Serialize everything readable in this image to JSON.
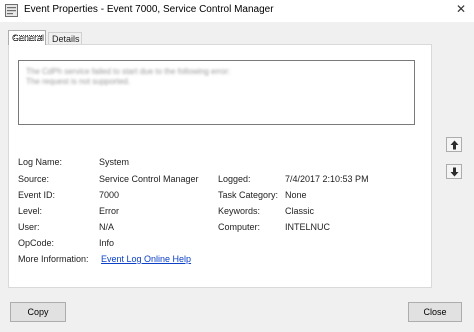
{
  "window": {
    "title": "Event Properties - Event 7000, Service Control Manager",
    "close_glyph": "✕"
  },
  "tabs": [
    {
      "label": "General",
      "selected": true
    },
    {
      "label": "Details",
      "selected": false
    }
  ],
  "description": {
    "lines": [
      "The CdPh service failed to start due to the following error:",
      "The request is not supported."
    ],
    "blurred": true
  },
  "fields": {
    "log_name": {
      "label_pre": "Log Name:",
      "value": "System"
    },
    "source": {
      "label_pre": "Source:",
      "value": "Service Control Manager"
    },
    "logged": {
      "label_pre": "Logged:",
      "value": "7/4/2017 2:10:53 PM"
    },
    "event_id": {
      "label_pre": "Event ID:",
      "value": "7000"
    },
    "task_category": {
      "label_pre": "Task Category:",
      "value": "None"
    },
    "level": {
      "label_pre": "Level:",
      "value": "Error"
    },
    "keywords": {
      "label_pre": "Keywords:",
      "value": "Classic"
    },
    "user": {
      "label_pre": "User:",
      "value": "N/A"
    },
    "computer": {
      "label_pre": "Computer:",
      "value": "INTELNUC"
    },
    "opcode": {
      "label_pre": "OpCode:",
      "value": "Info"
    },
    "more_info": {
      "label_pre": "More Information:",
      "link": "Event Log Online Help"
    }
  },
  "buttons": {
    "copy": "Copy",
    "close": "Close"
  },
  "icons": {
    "prev": "arrow-up-icon",
    "next": "arrow-down-icon"
  }
}
